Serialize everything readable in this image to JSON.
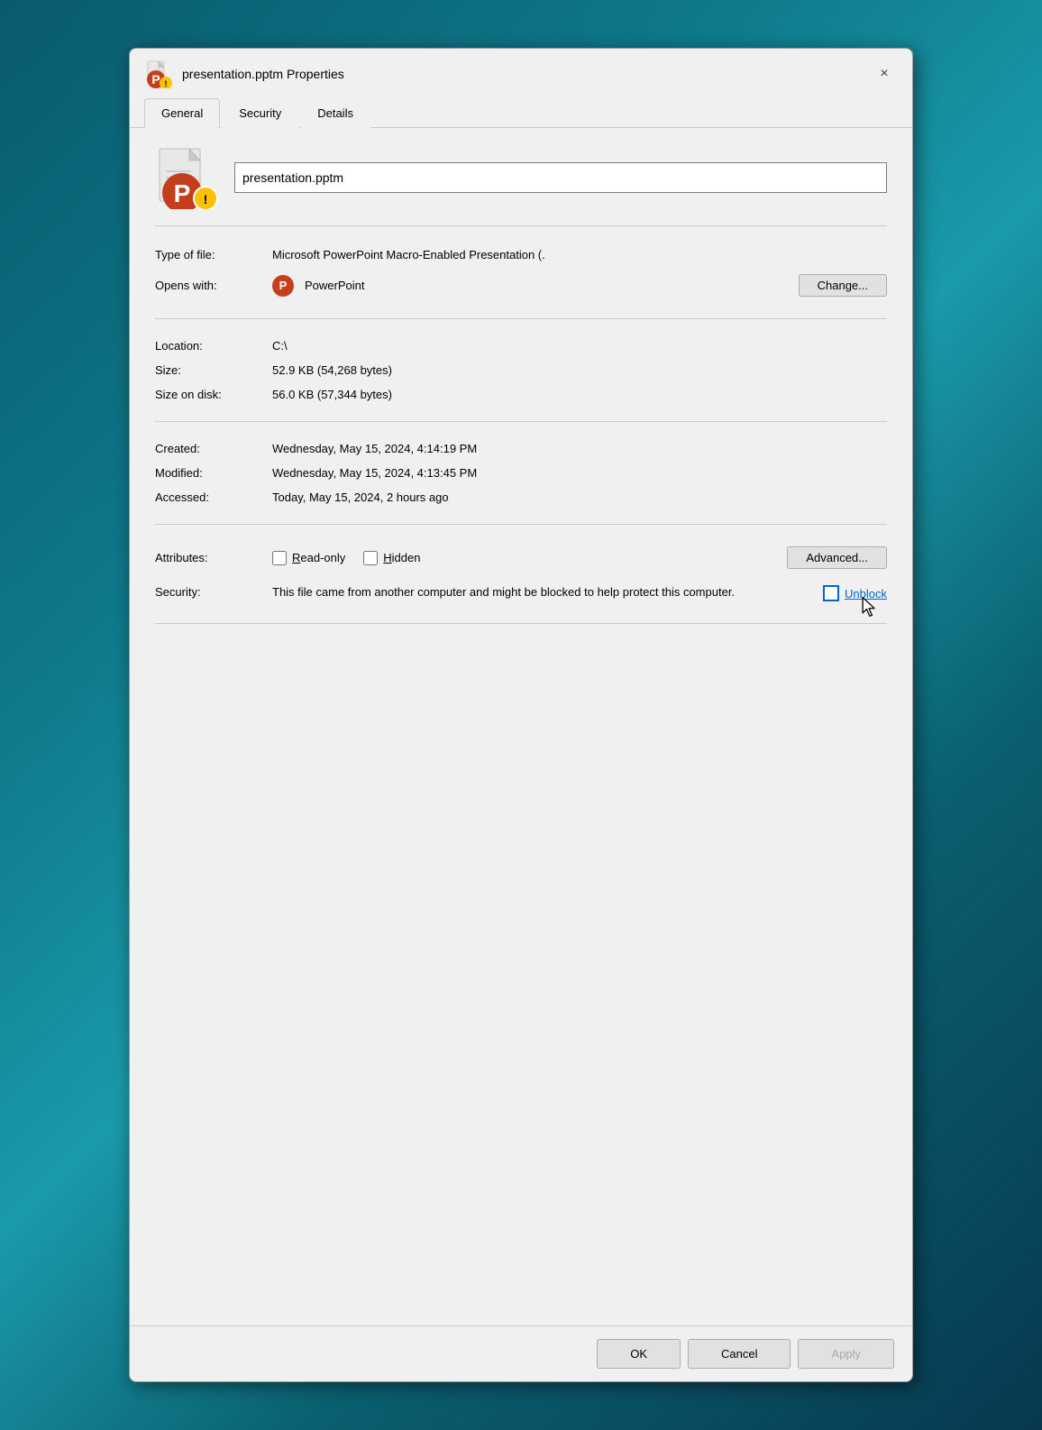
{
  "dialog": {
    "title": "presentation.pptm Properties",
    "close_label": "×"
  },
  "tabs": [
    {
      "id": "general",
      "label": "General",
      "active": true
    },
    {
      "id": "security",
      "label": "Security",
      "active": false
    },
    {
      "id": "details",
      "label": "Details",
      "active": false
    }
  ],
  "file_section": {
    "filename": "presentation.pptm"
  },
  "properties": {
    "type_label": "Type of file:",
    "type_value": "Microsoft PowerPoint Macro-Enabled Presentation (.",
    "opens_with_label": "Opens with:",
    "opens_with_app": "PowerPoint",
    "change_button": "Change...",
    "location_label": "Location:",
    "location_value": "C:\\",
    "size_label": "Size:",
    "size_value": "52.9 KB (54,268 bytes)",
    "size_on_disk_label": "Size on disk:",
    "size_on_disk_value": "56.0 KB (57,344 bytes)",
    "created_label": "Created:",
    "created_value": "Wednesday, May 15, 2024, 4:14:19 PM",
    "modified_label": "Modified:",
    "modified_value": "Wednesday, May 15, 2024, 4:13:45 PM",
    "accessed_label": "Accessed:",
    "accessed_value": "Today, May 15, 2024, 2 hours ago",
    "attributes_label": "Attributes:",
    "readonly_label": "Read-only",
    "hidden_label": "Hidden",
    "advanced_button": "Advanced...",
    "security_label": "Security:",
    "security_text": "This file came from another computer and might be blocked to help protect this computer.",
    "unblock_label": "Unblock"
  },
  "footer": {
    "ok_label": "OK",
    "cancel_label": "Cancel",
    "apply_label": "Apply"
  }
}
